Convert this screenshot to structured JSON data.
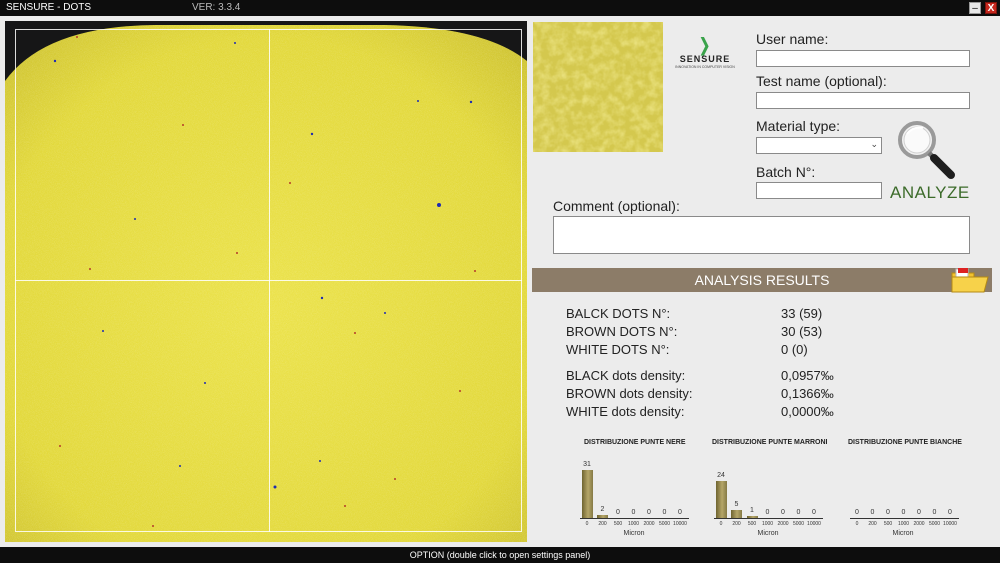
{
  "window": {
    "title": "SENSURE - DOTS",
    "version": "VER: 3.3.4",
    "minimize_icon": "minimize-icon",
    "close_icon": "close-icon"
  },
  "logo": {
    "brand": "SENSURE",
    "tagline": "INNOVATION IN COMPUTER VISION"
  },
  "form": {
    "user_name_label": "User name:",
    "user_name_value": "",
    "test_name_label": "Test name (optional):",
    "test_name_value": "",
    "material_type_label": "Material type:",
    "material_type_value": "",
    "batch_label": "Batch N°:",
    "batch_value": "",
    "comment_label": "Comment (optional):",
    "comment_value": "",
    "analyze_label": "ANALYZE"
  },
  "results": {
    "header": "ANALYSIS RESULTS",
    "rows": [
      {
        "label": "BALCK DOTS N°:",
        "value": "33 (59)"
      },
      {
        "label": "BROWN DOTS N°:",
        "value": "30 (53)"
      },
      {
        "label": "WHITE DOTS N°:",
        "value": "0 (0)"
      },
      {
        "label": "BLACK dots density:",
        "value": "0,0957‰"
      },
      {
        "label": "BROWN dots density:",
        "value": "0,1366‰"
      },
      {
        "label": "WHITE dots density:",
        "value": "0,0000‰"
      }
    ]
  },
  "histograms": [
    {
      "title": "DISTRIBUZIONE PUNTE NERE",
      "xlabel": "Micron",
      "ticks": [
        "0",
        "200",
        "500",
        "1000",
        "2000",
        "5000",
        "10000"
      ],
      "counts": [
        31,
        2,
        0,
        0,
        0,
        0,
        0
      ]
    },
    {
      "title": "DISTRIBUZIONE PUNTE MARRONI",
      "xlabel": "Micron",
      "ticks": [
        "0",
        "200",
        "500",
        "1000",
        "2000",
        "5000",
        "10000"
      ],
      "counts": [
        24,
        5,
        1,
        0,
        0,
        0,
        0
      ]
    },
    {
      "title": "DISTRIBUZIONE PUNTE BIANCHE",
      "xlabel": "Micron",
      "ticks": [
        "0",
        "200",
        "500",
        "1000",
        "2000",
        "5000",
        "10000"
      ],
      "counts": [
        0,
        0,
        0,
        0,
        0,
        0,
        0
      ]
    }
  ],
  "status": {
    "text": "OPTION (double click to open settings panel)"
  },
  "colors": {
    "sample_yellow": "#e6de3c",
    "results_header": "#8c7c68",
    "analyze_green": "#3c6b2a",
    "bar_gold": "#a89a5c"
  }
}
